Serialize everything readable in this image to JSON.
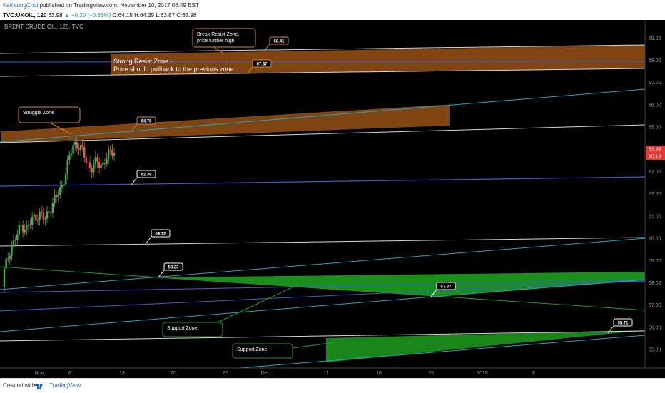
{
  "header": {
    "author": "KaKeungChoi",
    "published_text": "published on TradingView.com, November 10, 2017 06:49 EST"
  },
  "symbol_bar": {
    "symbol": "TVC:UKOIL, 120",
    "last": "63.98",
    "change": "+0.20 (+0.31%)",
    "ohlc": "O:64.15 H:64.25 L:63.87 C:63.98"
  },
  "chart_title": "BRENT CRUDE OIL, 120, TVC",
  "footer": {
    "created_with": "Created with",
    "brand": "TradingView"
  },
  "colors": {
    "background": "#000000",
    "resist_zone": "#8a4a12",
    "support_zone": "#1e9e1e",
    "price_up": "#26a69a",
    "price_label": "#e53935",
    "trend_cyan": "#1ea8c8",
    "trend_blue": "#3a5fd8"
  },
  "chart_data": {
    "type": "line",
    "title": "BRENT CRUDE OIL, 120, TVC",
    "ylim": [
      54.3,
      69.4
    ],
    "y_ticks": [
      "69.00",
      "68.00",
      "67.00",
      "66.00",
      "65.00",
      "64.00",
      "63.00",
      "62.00",
      "61.00",
      "60.00",
      "59.00",
      "58.00",
      "57.00",
      "56.00",
      "55.00"
    ],
    "x_ticks": [
      "Nov",
      "6",
      "13",
      "20",
      "27",
      "Dec",
      "11",
      "18",
      "25",
      "2018",
      "8"
    ],
    "last_price": "63.98",
    "countdown": "10:19",
    "level_labels": [
      "68.41",
      "67.37",
      "64.78",
      "62.39",
      "59.72",
      "58.23",
      "57.37",
      "55.71"
    ],
    "annotations": [
      "Break Resist Zone,\nprice further high",
      "Strong Resist Zone -\nPrice should pullback to the previous zone",
      "Struggle Zone",
      "Support Zone",
      "Support Zone"
    ],
    "candle_close_sample": [
      58.5,
      59.5,
      60.0,
      60.6,
      60.4,
      60.9,
      61.1,
      60.8,
      61.4,
      61.8,
      62.4,
      63.3,
      64.3,
      64.1,
      63.6,
      63.1,
      63.4,
      63.3,
      63.7,
      63.98
    ]
  }
}
